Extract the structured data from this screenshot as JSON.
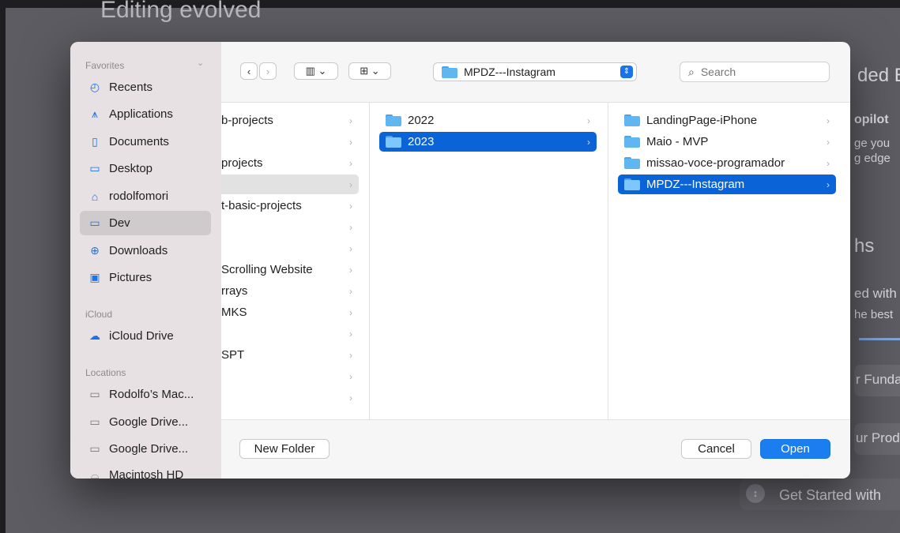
{
  "background": {
    "title": "Editing evolved",
    "texts": [
      "ded E",
      "opilot",
      "ge you",
      "g edge",
      "hs",
      "ed with",
      "he best",
      "r Funda",
      "ur Prod"
    ],
    "cta": "Get Started with"
  },
  "dialog": {
    "sidebar": {
      "favorites_header": "Favorites",
      "favorites": [
        {
          "label": "Recents",
          "icon": "clock-icon"
        },
        {
          "label": "Applications",
          "icon": "applications-icon"
        },
        {
          "label": "Documents",
          "icon": "document-icon"
        },
        {
          "label": "Desktop",
          "icon": "desktop-icon"
        },
        {
          "label": "rodolfomori",
          "icon": "home-icon"
        },
        {
          "label": "Dev",
          "icon": "folder-icon",
          "selected": true
        },
        {
          "label": "Downloads",
          "icon": "download-icon"
        },
        {
          "label": "Pictures",
          "icon": "pictures-icon"
        }
      ],
      "icloud_header": "iCloud",
      "icloud": [
        {
          "label": "iCloud Drive",
          "icon": "cloud-icon"
        }
      ],
      "locations_header": "Locations",
      "locations": [
        {
          "label": "Rodolfo’s Mac...",
          "icon": "laptop-icon"
        },
        {
          "label": "Google Drive...",
          "icon": "folder-icon"
        },
        {
          "label": "Google Drive...",
          "icon": "folder-icon"
        },
        {
          "label": "Macintosh HD",
          "icon": "disk-icon"
        }
      ]
    },
    "toolbar": {
      "back_icon": "chevron-left-icon",
      "forward_icon": "chevron-right-icon",
      "column_view_icon": "columns-icon",
      "group_icon": "grid-icon",
      "path": "MPDZ---Instagram",
      "search_placeholder": "Search"
    },
    "columns": {
      "col1": [
        {
          "label": "b-projects"
        },
        {
          "label": ""
        },
        {
          "label": "projects"
        },
        {
          "label": "",
          "state": "gray"
        },
        {
          "label": "t-basic-projects"
        },
        {
          "label": ""
        },
        {
          "label": ""
        },
        {
          "label": "Scrolling Website"
        },
        {
          "label": "rrays"
        },
        {
          "label": "MKS"
        },
        {
          "label": ""
        },
        {
          "label": "SPT"
        },
        {
          "label": ""
        },
        {
          "label": ""
        }
      ],
      "col2": [
        {
          "label": "2022"
        },
        {
          "label": "2023",
          "state": "selected"
        }
      ],
      "col3": [
        {
          "label": "LandingPage-iPhone"
        },
        {
          "label": "Maio - MVP"
        },
        {
          "label": "missao-voce-programador"
        },
        {
          "label": "MPDZ---Instagram",
          "state": "selected"
        }
      ]
    },
    "footer": {
      "new_folder": "New Folder",
      "cancel": "Cancel",
      "open": "Open"
    }
  }
}
